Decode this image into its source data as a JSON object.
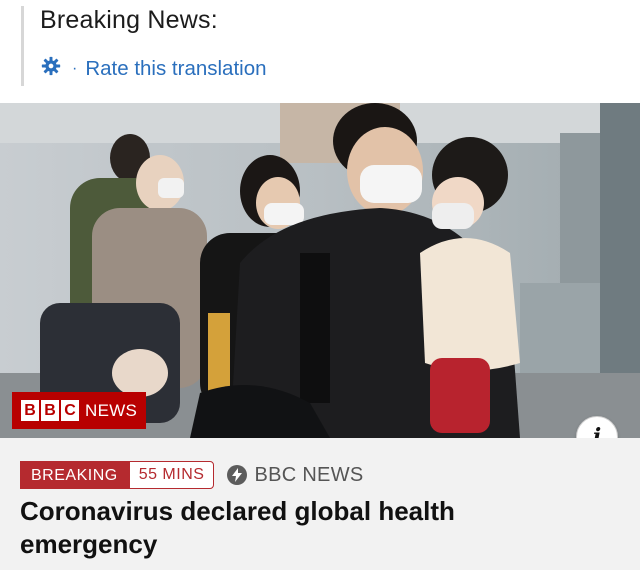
{
  "post": {
    "text": "Breaking News:",
    "translation_link": "Rate this translation",
    "separator": "·",
    "icon": "gear-icon",
    "link_color": "#2a6fbd"
  },
  "media": {
    "image_description": "Travellers wearing face masks at an airport, man carrying a toddler",
    "watermark": {
      "blocks": [
        "B",
        "B",
        "C"
      ],
      "text": "NEWS",
      "color": "#b80000"
    },
    "info_button": "i"
  },
  "article": {
    "tag_breaking": "BREAKING",
    "tag_time": "55 MINS",
    "source": "BBC NEWS",
    "source_icon": "lightning-bolt-icon",
    "headline": "Coronavirus declared global health emergency",
    "tag_color": "#b52a2f"
  }
}
